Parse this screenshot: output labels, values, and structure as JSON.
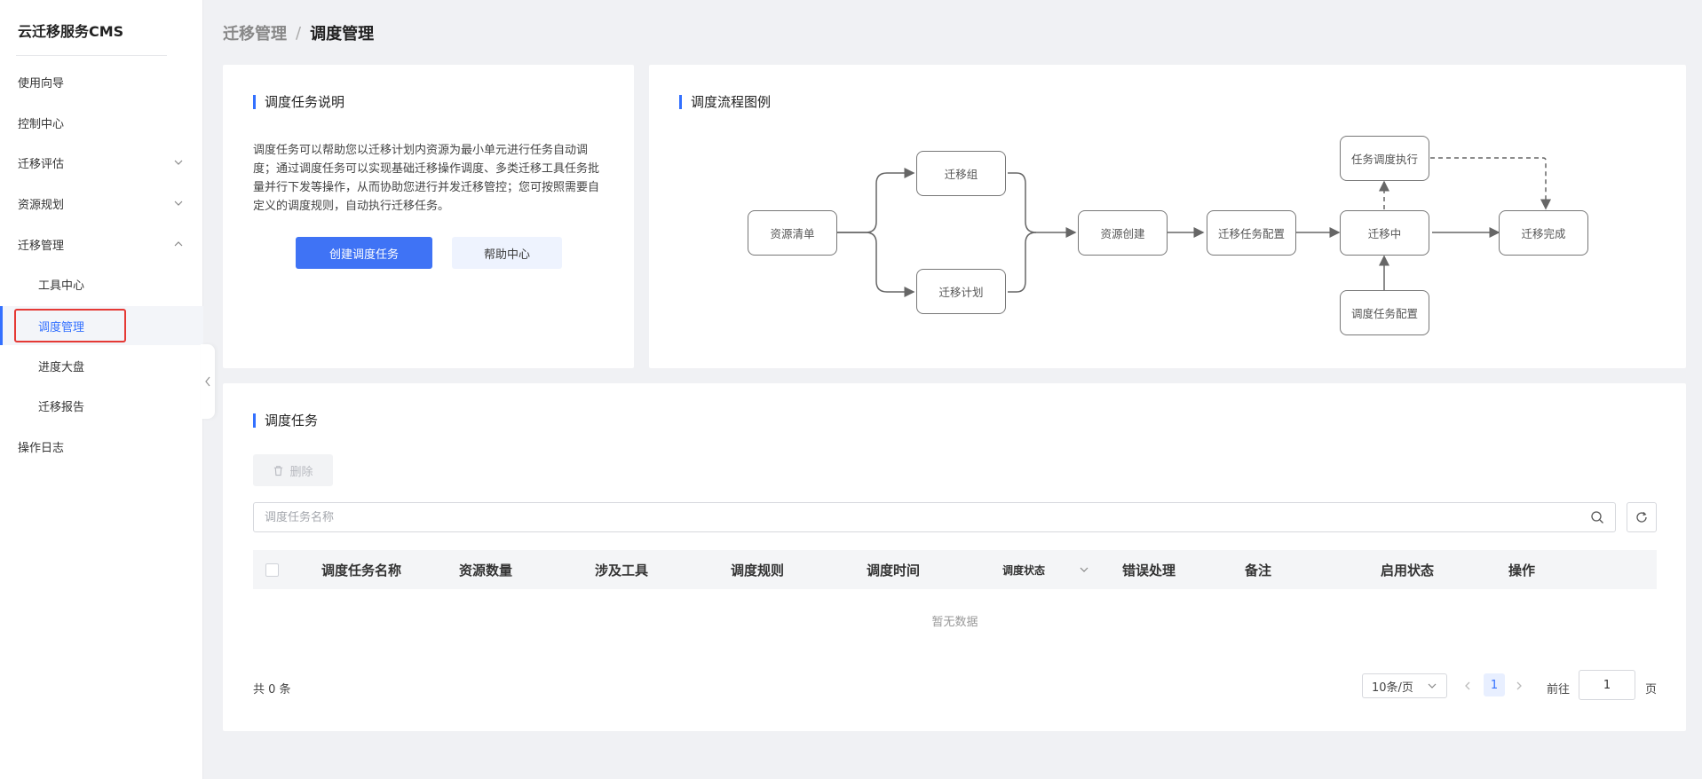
{
  "sidebar": {
    "brand": "云迁移服务CMS",
    "items": {
      "guide": "使用向导",
      "control": "控制中心",
      "assess": "迁移评估",
      "planning": "资源规划",
      "manage": "迁移管理",
      "tools": "工具中心",
      "schedule": "调度管理",
      "progress": "进度大盘",
      "report": "迁移报告",
      "logs": "操作日志"
    }
  },
  "breadcrumb": {
    "parent": "迁移管理",
    "separator": "/",
    "current": "调度管理"
  },
  "intro": {
    "title": "调度任务说明",
    "description": "调度任务可以帮助您以迁移计划内资源为最小单元进行任务自动调度；通过调度任务可以实现基础迁移操作调度、多类迁移工具任务批量并行下发等操作，从而协助您进行并发迁移管控；您可按照需要自定义的调度规则，自动执行迁移任务。",
    "create_button": "创建调度任务",
    "help_button": "帮助中心"
  },
  "flow": {
    "title": "调度流程图例",
    "nodes": {
      "resource_list": "资源清单",
      "migration_group": "迁移组",
      "migration_plan": "迁移计划",
      "resource_create": "资源创建",
      "task_config": "迁移任务配置",
      "migrating": "迁移中",
      "migration_done": "迁移完成",
      "schedule_exec": "任务调度执行",
      "schedule_config": "调度任务配置"
    }
  },
  "tasks": {
    "title": "调度任务",
    "delete_button": "删除",
    "search_placeholder": "调度任务名称",
    "columns": {
      "name": "调度任务名称",
      "count": "资源数量",
      "tools": "涉及工具",
      "rule": "调度规则",
      "time": "调度时间",
      "status": "调度状态",
      "error": "错误处理",
      "remark": "备注",
      "enabled": "启用状态",
      "action": "操作"
    },
    "empty_text": "暂无数据"
  },
  "pagination": {
    "total": "共 0 条",
    "page_size": "10条/页",
    "current_page": "1",
    "goto_label": "前往",
    "goto_value": "1",
    "page_suffix": "页"
  },
  "colors": {
    "accent": "#3370ff",
    "highlight": "#e53935"
  }
}
